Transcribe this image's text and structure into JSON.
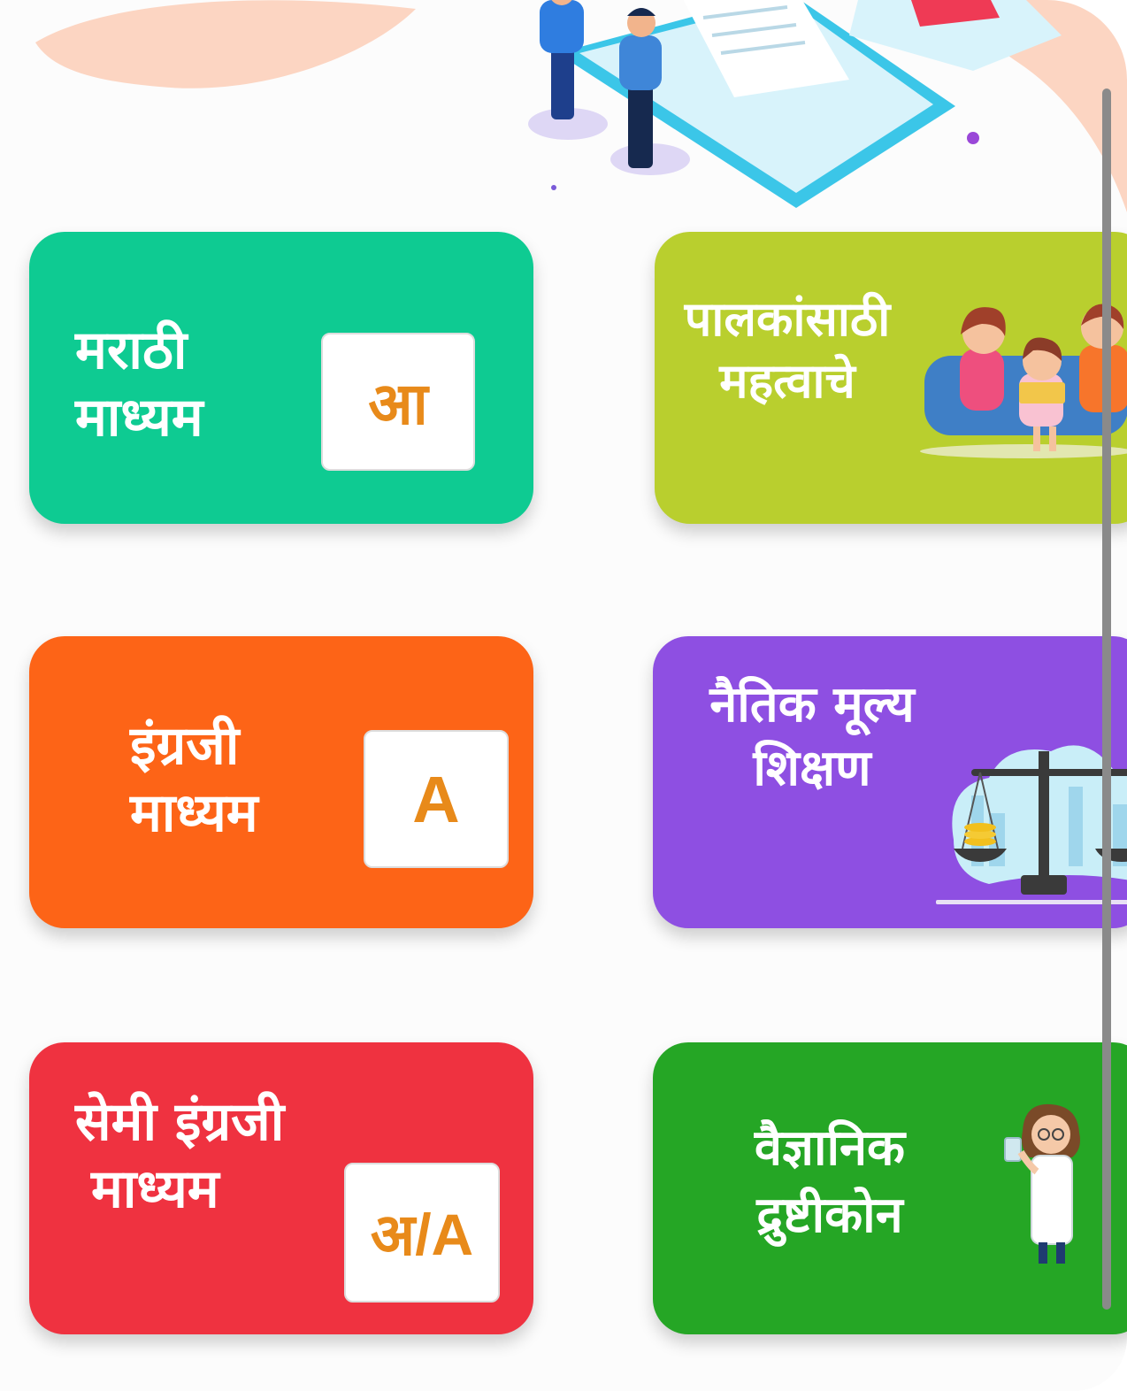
{
  "hero": {
    "illustration": "students-reading-book-illustration"
  },
  "tiles": [
    {
      "title_lines": [
        "मराठी",
        "माध्यम"
      ],
      "badge": "आ",
      "color": "#0ecb92",
      "icon": "marathi-letter-tile-icon"
    },
    {
      "title_lines": [
        "पालकांसाठी",
        "महत्वाचे"
      ],
      "color": "#b9cf2e",
      "icon": "family-reading-illustration"
    },
    {
      "title_lines": [
        "इंग्रजी",
        "माध्यम"
      ],
      "badge": "A",
      "color": "#fd6417",
      "icon": "english-letter-tile-icon"
    },
    {
      "title_lines": [
        "नैतिक मूल्य",
        "शिक्षण"
      ],
      "color": "#8e4fe2",
      "icon": "scales-of-justice-illustration"
    },
    {
      "title_lines": [
        "सेमी इंग्रजी",
        "माध्यम"
      ],
      "badge": "अ/A",
      "color": "#ef3240",
      "icon": "semi-english-letter-tile-icon"
    },
    {
      "title_lines": [
        "वैज्ञानिक",
        "द्रुष्टीकोन"
      ],
      "color": "#25a625",
      "icon": "scientist-illustration"
    }
  ]
}
